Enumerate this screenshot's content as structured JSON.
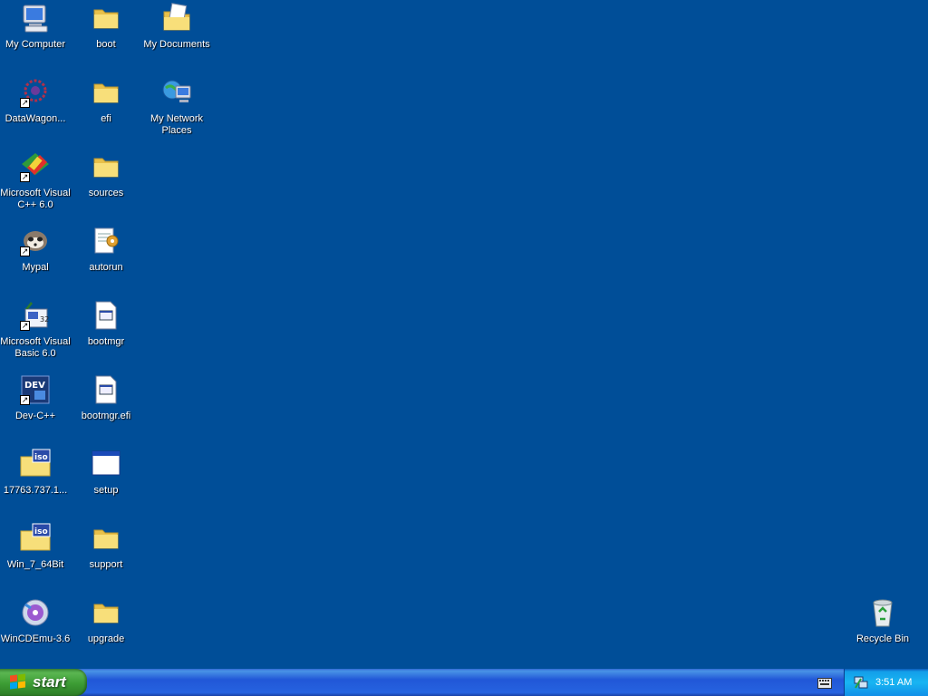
{
  "desktop": {
    "icons": [
      {
        "label": "My Computer",
        "icon": "my-computer-icon"
      },
      {
        "label": "boot",
        "icon": "folder-icon"
      },
      {
        "label": "My Documents",
        "icon": "my-documents-icon"
      },
      {
        "label": "DataWagon...",
        "icon": "datawagon-icon",
        "shortcut": true
      },
      {
        "label": "efi",
        "icon": "folder-icon"
      },
      {
        "label": "My Network Places",
        "icon": "network-places-icon"
      },
      {
        "label": "Microsoft Visual C++ 6.0",
        "icon": "visual-cpp-icon",
        "shortcut": true
      },
      {
        "label": "sources",
        "icon": "folder-icon"
      },
      {
        "label": "Mypal",
        "icon": "mypal-icon",
        "shortcut": true
      },
      {
        "label": "autorun",
        "icon": "autorun-icon"
      },
      {
        "label": "Microsoft Visual Basic 6.0",
        "icon": "visual-basic-icon",
        "shortcut": true
      },
      {
        "label": "bootmgr",
        "icon": "file-icon"
      },
      {
        "label": "Dev-C++",
        "icon": "dev-cpp-icon",
        "shortcut": true
      },
      {
        "label": "bootmgr.efi",
        "icon": "file-icon"
      },
      {
        "label": "17763.737.1...",
        "icon": "iso-icon"
      },
      {
        "label": "setup",
        "icon": "application-icon"
      },
      {
        "label": "Win_7_64Bit",
        "icon": "iso-icon"
      },
      {
        "label": "support",
        "icon": "folder-icon"
      },
      {
        "label": "WinCDEmu-3.6",
        "icon": "wincdemu-icon"
      },
      {
        "label": "upgrade",
        "icon": "folder-icon"
      },
      {
        "label": "Recycle Bin",
        "icon": "recycle-bin-icon"
      }
    ]
  },
  "taskbar": {
    "start_label": "start",
    "clock": "3:51 AM",
    "tray_icons": [
      "keyboard-icon",
      "network-tray-icon"
    ]
  },
  "colors": {
    "desktop_bg": "#004e98",
    "taskbar_blue": "#2157d7",
    "start_green": "#3c9c34"
  }
}
